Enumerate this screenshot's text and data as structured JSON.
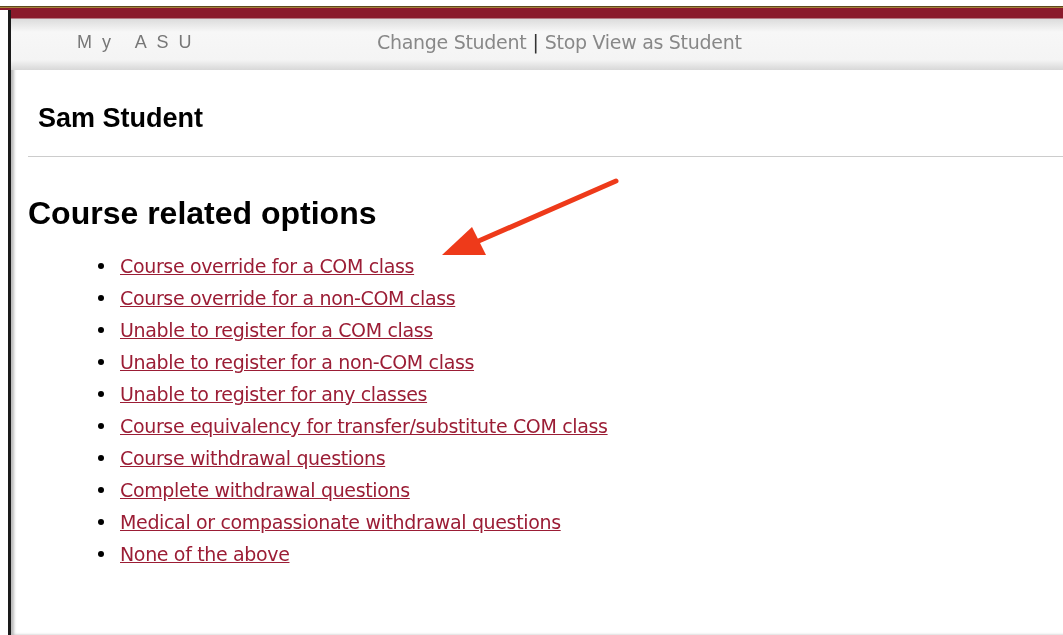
{
  "header": {
    "logo": "My ASU",
    "links": [
      "Change Student",
      "Stop View as Student"
    ],
    "separator": "|"
  },
  "student_name": "Sam Student",
  "section": {
    "title": "Course related options",
    "items": [
      "Course override for a COM class",
      "Course override for a non-COM class",
      "Unable to register for a COM class",
      "Unable to register for a non-COM class",
      "Unable to register for any classes",
      "Course equivalency for transfer/substitute COM class",
      "Course withdrawal questions",
      "Complete withdrawal questions",
      "Medical or compassionate withdrawal questions",
      "None of the above"
    ]
  }
}
